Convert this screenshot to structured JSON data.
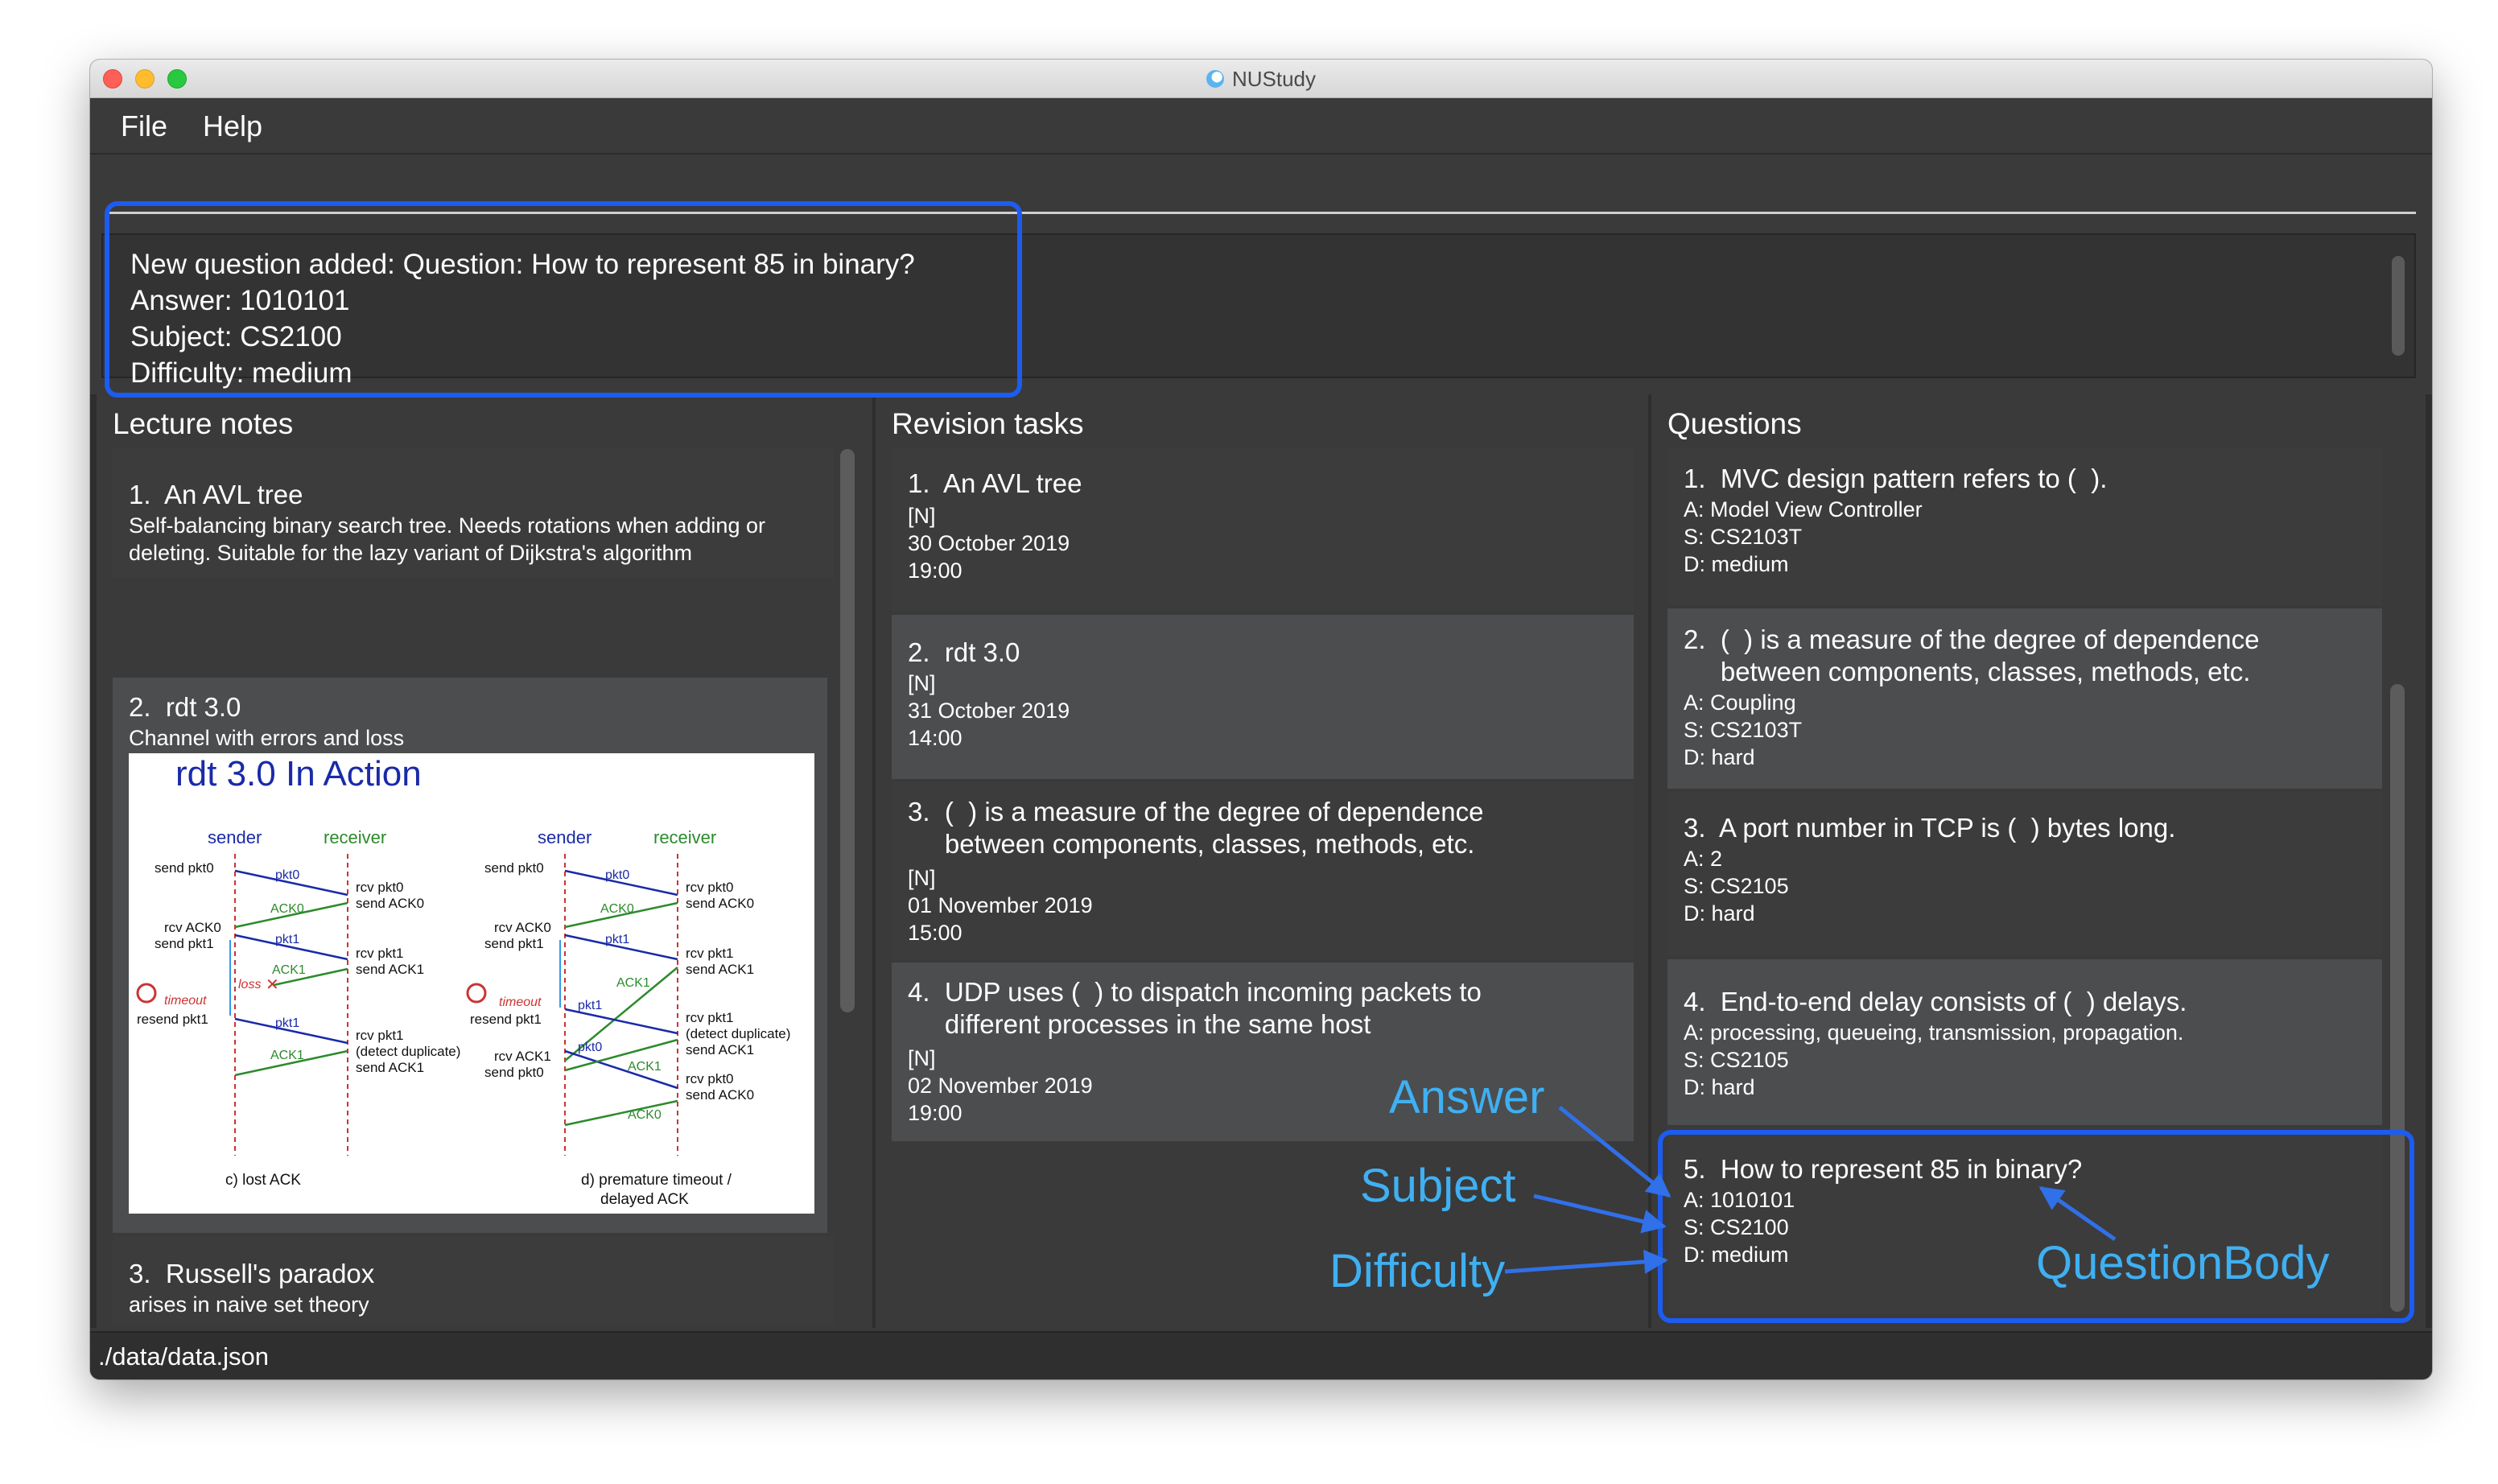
{
  "window": {
    "title": "NUStudy"
  },
  "menu": {
    "file": "File",
    "help": "Help"
  },
  "result": {
    "lines": [
      "New question added: Question: How to represent 85 in binary?",
      "Answer: 1010101",
      "Subject: CS2100",
      "Difficulty: medium"
    ]
  },
  "notes": {
    "title": "Lecture notes",
    "items": [
      {
        "title": "1.  An AVL tree",
        "lines": [
          "Self-balancing binary search tree. Needs rotations when adding or",
          "deleting. Suitable for the lazy variant of Dijkstra's algorithm"
        ]
      },
      {
        "title": "2.  rdt 3.0",
        "lines": [
          "Channel with errors and loss"
        ]
      },
      {
        "title": "3.  Russell's paradox",
        "lines": [
          "arises in naive set theory"
        ]
      }
    ],
    "diagram": {
      "heading": "rdt 3.0 In Action",
      "sender": "sender",
      "receiver": "receiver",
      "left_caption": "c)  lost ACK",
      "right_caption_1": "d)  premature timeout /",
      "right_caption_2": "delayed ACK",
      "timeout": "timeout",
      "loss": "loss",
      "left_sender_labels": [
        "send pkt0",
        "rcv ACK0",
        "send pkt1",
        "resend pkt1"
      ],
      "left_receiver_labels": [
        "rcv pkt0",
        "send ACK0",
        "rcv pkt1",
        "send ACK1",
        "rcv pkt1",
        "(detect duplicate)",
        "send ACK1"
      ],
      "left_arrow_labels": [
        "pkt0",
        "ACK0",
        "pkt1",
        "ACK1",
        "pkt1",
        "ACK1"
      ],
      "right_sender_labels": [
        "send pkt0",
        "rcv ACK0",
        "send pkt1",
        "resend pkt1",
        "rcv ACK1",
        "send pkt0"
      ],
      "right_receiver_labels": [
        "rcv pkt0",
        "send ACK0",
        "rcv pkt1",
        "send ACK1",
        "rcv pkt1",
        "(detect duplicate)",
        "send ACK1",
        "rcv pkt0",
        "send ACK0"
      ],
      "right_arrow_labels": [
        "pkt0",
        "ACK0",
        "pkt1",
        "ACK1",
        "pkt1",
        "pkt0",
        "ACK1",
        "ACK0"
      ]
    }
  },
  "tasks": {
    "title": "Revision tasks",
    "items": [
      {
        "title": "1.  An AVL tree",
        "lines": [
          "[N]",
          "30 October 2019",
          "19:00"
        ]
      },
      {
        "title": "2.  rdt 3.0",
        "lines": [
          "[N]",
          "31 October 2019",
          "14:00"
        ]
      },
      {
        "title": "3.  (  ) is a measure of the degree of dependence",
        "title2": "     between components, classes, methods, etc.",
        "lines": [
          "[N]",
          "01 November 2019",
          "15:00"
        ]
      },
      {
        "title": "4.  UDP uses (  ) to dispatch incoming packets to",
        "title2": "     different processes in the same host",
        "lines": [
          "[N]",
          "02 November 2019",
          "19:00"
        ]
      }
    ]
  },
  "questions": {
    "title": "Questions",
    "items": [
      {
        "title": "1.  MVC design pattern refers to (  ).",
        "lines": [
          "A: Model View Controller",
          "S: CS2103T",
          "D: medium"
        ]
      },
      {
        "title": "2.  (  ) is a measure of the degree of dependence",
        "title2": "     between components, classes, methods, etc.",
        "lines": [
          "A: Coupling",
          "S: CS2103T",
          "D: hard"
        ]
      },
      {
        "title": "3.  A port number in TCP is (  ) bytes long.",
        "lines": [
          "A: 2",
          "S: CS2105",
          "D: hard"
        ]
      },
      {
        "title": "4.  End-to-end delay consists of (  ) delays.",
        "lines": [
          "A: processing, queueing, transmission, propagation.",
          "S: CS2105",
          "D: hard"
        ]
      },
      {
        "title": "5.  How to represent 85 in binary?",
        "lines": [
          "A: 1010101",
          "S: CS2100",
          "D: medium"
        ]
      }
    ]
  },
  "status": {
    "path": "./data/data.json"
  },
  "annotations": {
    "answer": "Answer",
    "subject": "Subject",
    "difficulty": "Difficulty",
    "question_body": "QuestionBody"
  },
  "colors": {
    "highlight": "#1d5cf0",
    "annotation": "#3fb0f2"
  }
}
